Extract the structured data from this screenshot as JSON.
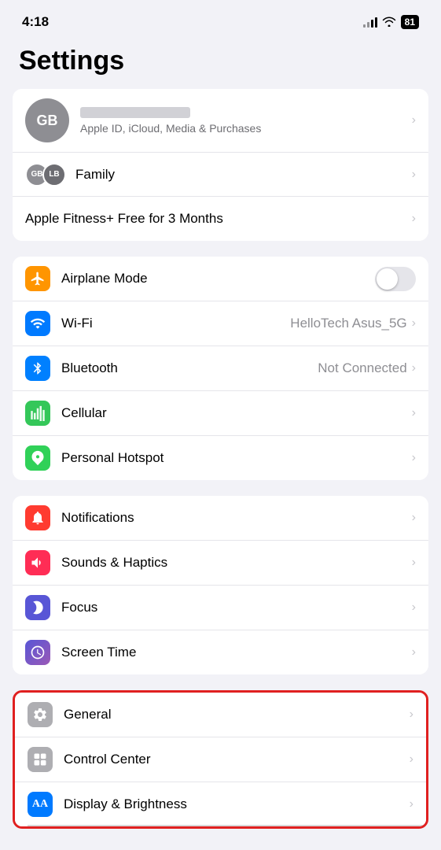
{
  "statusBar": {
    "time": "4:18",
    "battery": "81"
  },
  "pageTitle": "Settings",
  "profileCard": {
    "initials": "GB",
    "nameBlurred": true,
    "subtitle": "Apple ID, iCloud, Media & Purchases",
    "familyLabel": "Family",
    "familyInitials1": "GB",
    "familyInitials2": "LB",
    "fitnessLabel": "Apple Fitness+ Free for 3 Months"
  },
  "networkCard": {
    "items": [
      {
        "id": "airplane",
        "label": "Airplane Mode",
        "value": "",
        "showToggle": true
      },
      {
        "id": "wifi",
        "label": "Wi-Fi",
        "value": "HelloTech Asus_5G",
        "showToggle": false
      },
      {
        "id": "bluetooth",
        "label": "Bluetooth",
        "value": "Not Connected",
        "showToggle": false
      },
      {
        "id": "cellular",
        "label": "Cellular",
        "value": "",
        "showToggle": false
      },
      {
        "id": "hotspot",
        "label": "Personal Hotspot",
        "value": "",
        "showToggle": false
      }
    ]
  },
  "notifCard": {
    "items": [
      {
        "id": "notifications",
        "label": "Notifications",
        "value": ""
      },
      {
        "id": "sounds",
        "label": "Sounds & Haptics",
        "value": ""
      },
      {
        "id": "focus",
        "label": "Focus",
        "value": ""
      },
      {
        "id": "screentime",
        "label": "Screen Time",
        "value": ""
      }
    ]
  },
  "systemCard": {
    "items": [
      {
        "id": "general",
        "label": "General",
        "value": "",
        "highlighted": true
      },
      {
        "id": "controlcenter",
        "label": "Control Center",
        "value": ""
      },
      {
        "id": "display",
        "label": "Display & Brightness",
        "value": ""
      }
    ]
  }
}
